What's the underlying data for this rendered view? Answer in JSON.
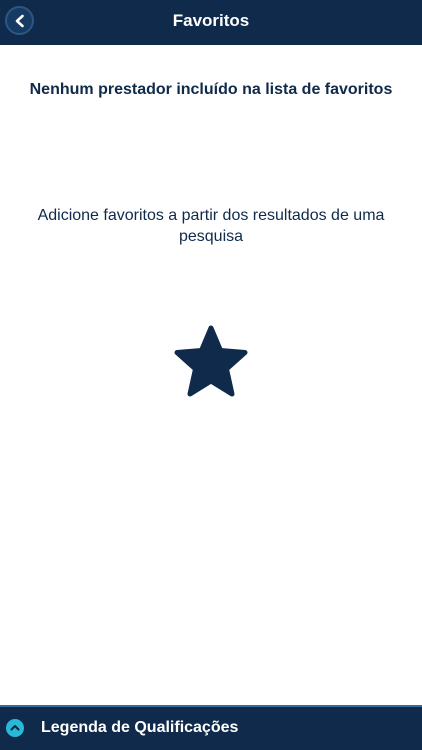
{
  "header": {
    "title": "Favoritos",
    "back_icon": "chevron-left-icon"
  },
  "empty_state": {
    "title": "Nenhum prestador incluído na lista de favoritos",
    "message": "Adicione favoritos a partir dos resultados de uma pesquisa",
    "icon": "star-icon"
  },
  "footer": {
    "label": "Legenda de Qualificações",
    "icon": "chevron-up-icon"
  },
  "colors": {
    "primary": "#0f2a4a",
    "accent": "#29b8d8",
    "background": "#ffffff"
  }
}
